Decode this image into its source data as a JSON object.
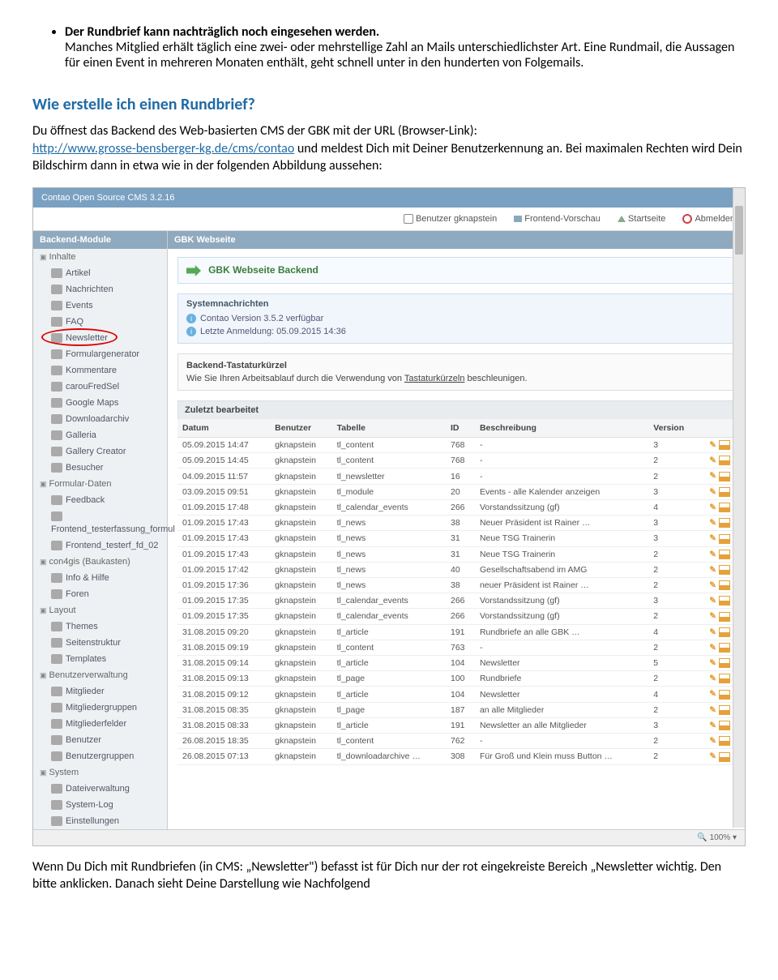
{
  "doc": {
    "bullet1_bold": "Der Rundbrief kann nachträglich noch eingesehen werden.",
    "bullet1_rest": "Manches Mitglied erhält täglich eine zwei- oder mehrstellige Zahl an Mails unterschiedlichster Art. Eine Rundmail, die Aussagen für einen Event in mehreren Monaten enthält, geht schnell unter in den hunderten von Folgemails.",
    "heading": "Wie erstelle ich einen Rundbrief?",
    "p1_a": "Du öffnest das Backend des Web-basierten CMS der GBK mit der URL (Browser-Link):",
    "link": "http://www.grosse-bensberger-kg.de/cms/contao",
    "p1_b": " und meldest Dich mit Deiner Benutzerkennung an. Bei maximalen Rechten wird Dein Bildschirm dann in etwa wie in der folgenden Abbildung aussehen:",
    "p2": "Wenn Du Dich mit Rundbriefen (in CMS: „Newsletter\") befasst ist für Dich nur der rot eingekreiste Bereich „Newsletter wichtig. Den bitte anklicken. Danach sieht Deine Darstellung wie Nachfolgend"
  },
  "shot": {
    "title": "Contao Open Source CMS 3.2.16",
    "userbar": {
      "user": "Benutzer gknapstein",
      "preview": "Frontend-Vorschau",
      "home": "Startseite",
      "logout": "Abmelden"
    },
    "sidebar": {
      "header": "Backend-Module",
      "groups": [
        {
          "label": "Inhalte",
          "items": [
            "Artikel",
            "Nachrichten",
            "Events",
            "FAQ",
            "Newsletter",
            "Formulargenerator",
            "Kommentare",
            "carouFredSel",
            "Google Maps",
            "Downloadarchiv",
            "Galleria",
            "Gallery Creator",
            "Besucher"
          ]
        },
        {
          "label": "Formular-Daten",
          "items": [
            "Feedback",
            "Frontend_testerfassung_formul",
            "Frontend_testerf_fd_02"
          ]
        },
        {
          "label": "con4gis (Baukasten)",
          "items": [
            "Info & Hilfe",
            "Foren"
          ]
        },
        {
          "label": "Layout",
          "items": [
            "Themes",
            "Seitenstruktur",
            "Templates"
          ]
        },
        {
          "label": "Benutzerverwaltung",
          "items": [
            "Mitglieder",
            "Mitgliedergruppen",
            "Mitgliederfelder",
            "Benutzer",
            "Benutzergruppen"
          ]
        },
        {
          "label": "System",
          "items": [
            "Dateiverwaltung",
            "System-Log",
            "Einstellungen"
          ]
        }
      ]
    },
    "main": {
      "header": "GBK Webseite",
      "gbk_title": "GBK Webseite Backend",
      "sys_title": "Systemnachrichten",
      "sys_lines": [
        "Contao Version 3.5.2 verfügbar",
        "Letzte Anmeldung: 05.09.2015 14:36"
      ],
      "short_title": "Backend-Tastaturkürzel",
      "short_text_a": "Wie Sie Ihren Arbeitsablauf durch die Verwendung von ",
      "short_text_link": "Tastaturkürzeln",
      "short_text_b": " beschleunigen.",
      "table_title": "Zuletzt bearbeitet",
      "cols": [
        "Datum",
        "Benutzer",
        "Tabelle",
        "ID",
        "Beschreibung",
        "Version"
      ],
      "rows": [
        [
          "05.09.2015 14:47",
          "gknapstein",
          "tl_content",
          "768",
          "-",
          "3"
        ],
        [
          "05.09.2015 14:45",
          "gknapstein",
          "tl_content",
          "768",
          "-",
          "2"
        ],
        [
          "04.09.2015 11:57",
          "gknapstein",
          "tl_newsletter",
          "16",
          "-",
          "2"
        ],
        [
          "03.09.2015 09:51",
          "gknapstein",
          "tl_module",
          "20",
          "Events - alle Kalender anzeigen",
          "3"
        ],
        [
          "01.09.2015 17:48",
          "gknapstein",
          "tl_calendar_events",
          "266",
          "Vorstandssitzung (gf)",
          "4"
        ],
        [
          "01.09.2015 17:43",
          "gknapstein",
          "tl_news",
          "38",
          "Neuer Präsident ist Rainer …",
          "3"
        ],
        [
          "01.09.2015 17:43",
          "gknapstein",
          "tl_news",
          "31",
          "Neue TSG Trainerin",
          "3"
        ],
        [
          "01.09.2015 17:43",
          "gknapstein",
          "tl_news",
          "31",
          "Neue TSG Trainerin",
          "2"
        ],
        [
          "01.09.2015 17:42",
          "gknapstein",
          "tl_news",
          "40",
          "Gesellschaftsabend im AMG",
          "2"
        ],
        [
          "01.09.2015 17:36",
          "gknapstein",
          "tl_news",
          "38",
          "neuer Präsident ist Rainer …",
          "2"
        ],
        [
          "01.09.2015 17:35",
          "gknapstein",
          "tl_calendar_events",
          "266",
          "Vorstandssitzung (gf)",
          "3"
        ],
        [
          "01.09.2015 17:35",
          "gknapstein",
          "tl_calendar_events",
          "266",
          "Vorstandssitzung (gf)",
          "2"
        ],
        [
          "31.08.2015 09:20",
          "gknapstein",
          "tl_article",
          "191",
          "Rundbriefe an alle GBK …",
          "4"
        ],
        [
          "31.08.2015 09:19",
          "gknapstein",
          "tl_content",
          "763",
          "-",
          "2"
        ],
        [
          "31.08.2015 09:14",
          "gknapstein",
          "tl_article",
          "104",
          "Newsletter",
          "5"
        ],
        [
          "31.08.2015 09:13",
          "gknapstein",
          "tl_page",
          "100",
          "Rundbriefe",
          "2"
        ],
        [
          "31.08.2015 09:12",
          "gknapstein",
          "tl_article",
          "104",
          "Newsletter",
          "4"
        ],
        [
          "31.08.2015 08:35",
          "gknapstein",
          "tl_page",
          "187",
          "an alle Mitglieder",
          "2"
        ],
        [
          "31.08.2015 08:33",
          "gknapstein",
          "tl_article",
          "191",
          "Newsletter an alle Mitglieder",
          "3"
        ],
        [
          "26.08.2015 18:35",
          "gknapstein",
          "tl_content",
          "762",
          "-",
          "2"
        ],
        [
          "26.08.2015 07:13",
          "gknapstein",
          "tl_downloadarchive …",
          "308",
          "Für Groß und Klein muss Button …",
          "2"
        ]
      ]
    },
    "zoom": "100%"
  }
}
